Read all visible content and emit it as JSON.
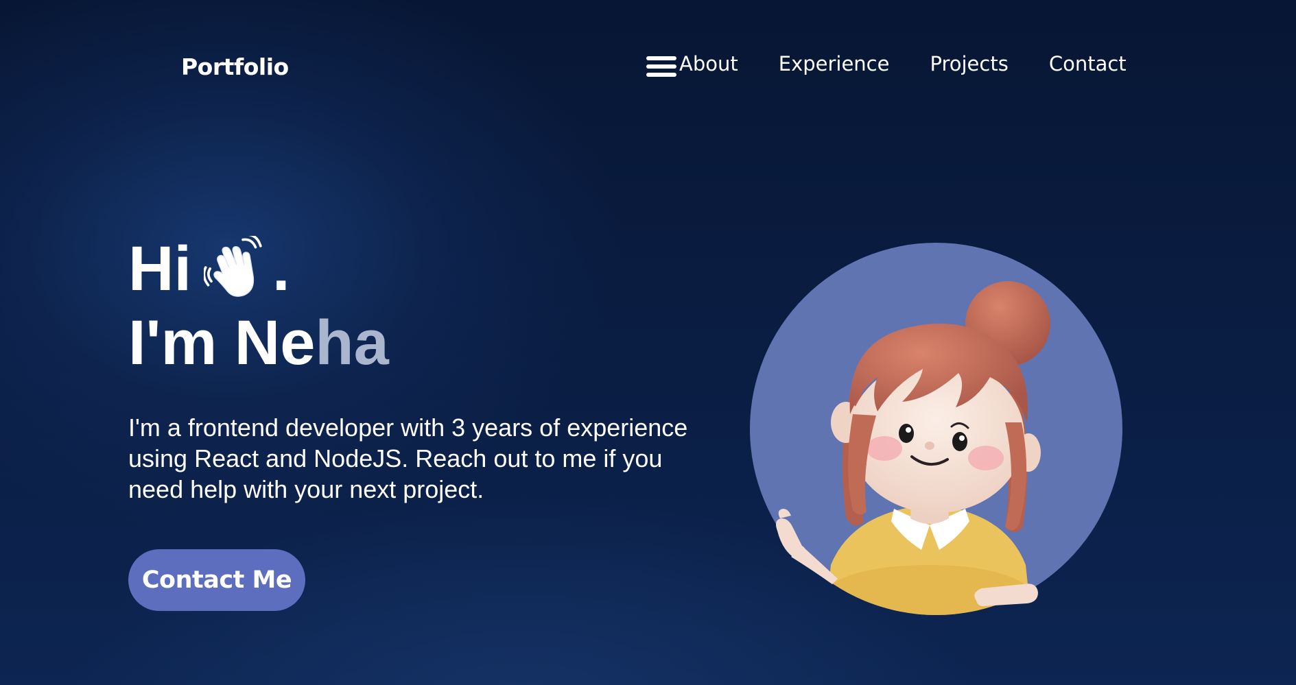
{
  "nav": {
    "brand": "Portfolio",
    "links": [
      "About",
      "Experience",
      "Projects",
      "Contact"
    ],
    "menu_icon": "hamburger-menu-icon"
  },
  "hero": {
    "greeting": "Hi",
    "greeting_icon": "waving-hand-icon",
    "greeting_suffix": ".",
    "name_prefix": "I'm Ne",
    "name_suffix": "ha",
    "bio": "I'm a frontend developer with 3 years of experience using React and NodeJS. Reach out to me if you need help with your next project.",
    "cta_label": "Contact Me"
  },
  "avatar": {
    "icon": "cartoon-girl-avatar"
  },
  "colors": {
    "background": "#0a1d42",
    "accent": "#5c6ebd",
    "avatar_circle": "#6174b2",
    "name_fade": "#a9b6cd",
    "text": "#ffffff"
  }
}
